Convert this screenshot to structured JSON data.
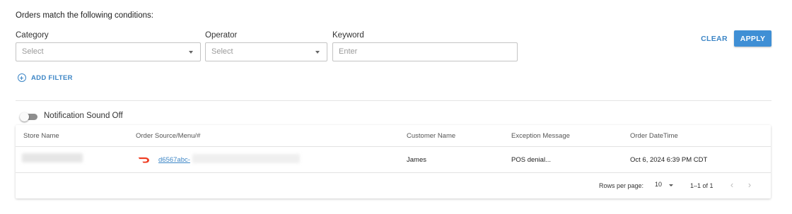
{
  "filters": {
    "heading": "Orders match the following conditions:",
    "category": {
      "label": "Category",
      "placeholder": "Select"
    },
    "operator": {
      "label": "Operator",
      "placeholder": "Select"
    },
    "keyword": {
      "label": "Keyword",
      "placeholder": "Enter"
    },
    "clear_label": "CLEAR",
    "apply_label": "APPLY",
    "add_filter_label": "ADD FILTER"
  },
  "notification": {
    "label": "Notification Sound Off",
    "enabled": false
  },
  "table": {
    "columns": [
      "Store Name",
      "Order Source/Menu/#",
      "Customer Name",
      "Exception Message",
      "Order DateTime"
    ],
    "rows": [
      {
        "store_name": "",
        "source_icon": "doordash-icon",
        "order_number": "d6567abc-",
        "customer_name": "James",
        "exception_message": "POS denial...",
        "order_datetime": "Oct 6, 2024 6:39 PM CDT"
      }
    ]
  },
  "pagination": {
    "rows_per_page_label": "Rows per page:",
    "rows_per_page": "10",
    "range": "1–1 of 1",
    "prev_icon": "chevron-left-icon",
    "next_icon": "chevron-right-icon"
  },
  "colors": {
    "accent": "#3d86c6",
    "apply_bg": "#3f8fd5",
    "doordash": "#ef3e23"
  }
}
